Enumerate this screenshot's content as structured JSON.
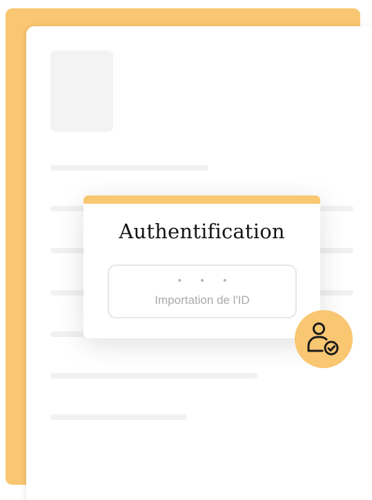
{
  "auth_card": {
    "title": "Authentification",
    "import_box": {
      "dots": "• • •",
      "label": "Importation de l'ID"
    }
  },
  "icons": {
    "badge": "user-check-icon"
  },
  "colors": {
    "accent": "#f9c671",
    "placeholder": "#f1f1f1",
    "text_dark": "#151515",
    "text_muted": "#a9a9a9"
  }
}
